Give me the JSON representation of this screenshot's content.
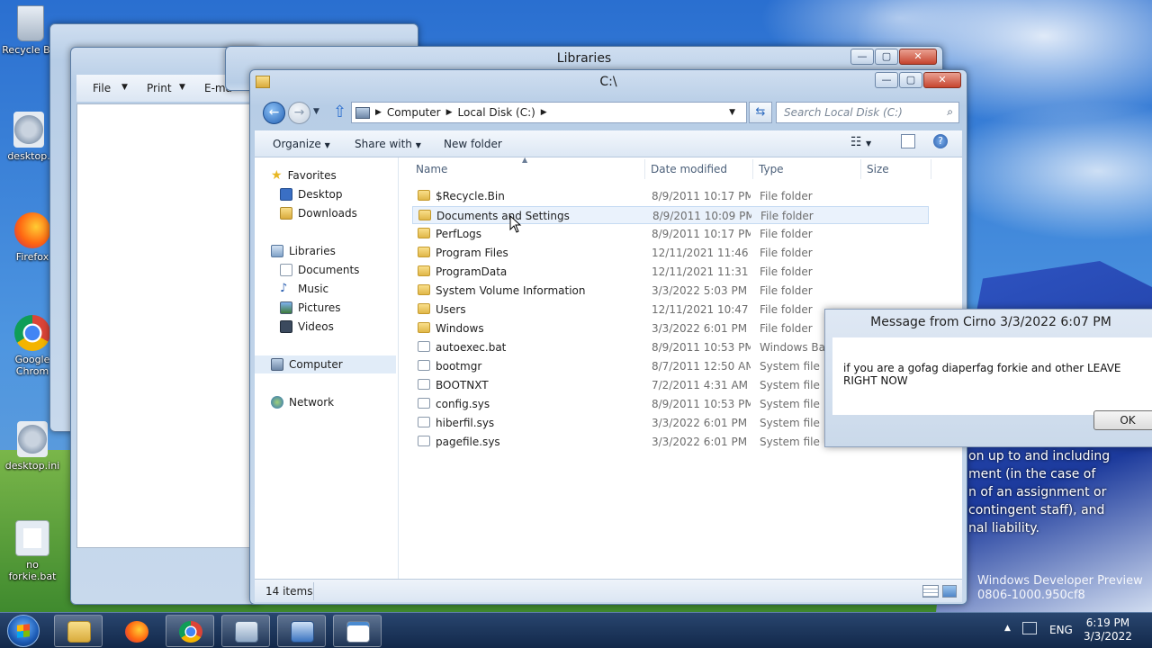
{
  "desktop": {
    "icons": [
      {
        "label": "Recycle Bin",
        "icon": "recycle-bin-icon"
      },
      {
        "label": "desktop.",
        "icon": "settings-file-icon"
      },
      {
        "label": "Firefox",
        "icon": "firefox-icon"
      },
      {
        "label": "Google Chrom",
        "icon": "chrome-icon"
      },
      {
        "label": "desktop.ini",
        "icon": "settings-file-icon"
      },
      {
        "label": "no forkie.bat",
        "icon": "batch-file-icon"
      }
    ],
    "background_text": "on up to and including\nment (in the case of\nn of an assignment or\ncontingent staff), and\nnal liability.",
    "watermark": "Windows Developer Preview\n0806-1000.950cf8"
  },
  "back_window": {
    "menu": [
      "File",
      "Print",
      "E-ma"
    ]
  },
  "libraries_window": {
    "title": "Libraries"
  },
  "explorer": {
    "title": "C:\\",
    "breadcrumb": [
      "Computer",
      "Local Disk (C:)"
    ],
    "search_placeholder": "Search Local Disk (C:)",
    "toolbar": {
      "organize": "Organize",
      "share": "Share with",
      "new_folder": "New folder"
    },
    "columns": {
      "name": "Name",
      "date": "Date modified",
      "type": "Type",
      "size": "Size"
    },
    "nav": {
      "favorites": "Favorites",
      "desktop": "Desktop",
      "downloads": "Downloads",
      "libraries": "Libraries",
      "documents": "Documents",
      "music": "Music",
      "pictures": "Pictures",
      "videos": "Videos",
      "computer": "Computer",
      "network": "Network"
    },
    "files": [
      {
        "name": "$Recycle.Bin",
        "date": "8/9/2011 10:17 PM",
        "type": "File folder",
        "kind": "folder"
      },
      {
        "name": "Documents and Settings",
        "date": "8/9/2011 10:09 PM",
        "type": "File folder",
        "kind": "folder-link"
      },
      {
        "name": "PerfLogs",
        "date": "8/9/2011 10:17 PM",
        "type": "File folder",
        "kind": "folder"
      },
      {
        "name": "Program Files",
        "date": "12/11/2021 11:46 ...",
        "type": "File folder",
        "kind": "folder"
      },
      {
        "name": "ProgramData",
        "date": "12/11/2021 11:31 ...",
        "type": "File folder",
        "kind": "folder"
      },
      {
        "name": "System Volume Information",
        "date": "3/3/2022 5:03 PM",
        "type": "File folder",
        "kind": "folder"
      },
      {
        "name": "Users",
        "date": "12/11/2021 10:47 ...",
        "type": "File folder",
        "kind": "folder"
      },
      {
        "name": "Windows",
        "date": "3/3/2022 6:01 PM",
        "type": "File folder",
        "kind": "folder"
      },
      {
        "name": "autoexec.bat",
        "date": "8/9/2011 10:53 PM",
        "type": "Windows Batc",
        "kind": "file"
      },
      {
        "name": "bootmgr",
        "date": "8/7/2011 12:50 AM",
        "type": "System file",
        "kind": "file"
      },
      {
        "name": "BOOTNXT",
        "date": "7/2/2011 4:31 AM",
        "type": "System file",
        "kind": "file"
      },
      {
        "name": "config.sys",
        "date": "8/9/2011 10:53 PM",
        "type": "System file",
        "kind": "file"
      },
      {
        "name": "hiberfil.sys",
        "date": "3/3/2022 6:01 PM",
        "type": "System file",
        "kind": "file"
      },
      {
        "name": "pagefile.sys",
        "date": "3/3/2022 6:01 PM",
        "type": "System file",
        "kind": "file"
      }
    ],
    "status": "14 items"
  },
  "dialog": {
    "title": "Message from Cirno 3/3/2022 6:07 PM",
    "message": "if you are a gofag diaperfag forkie and other LEAVE RIGHT NOW",
    "ok": "OK"
  },
  "taskbar": {
    "language": "ENG",
    "time": "6:19 PM",
    "date": "3/3/2022"
  }
}
